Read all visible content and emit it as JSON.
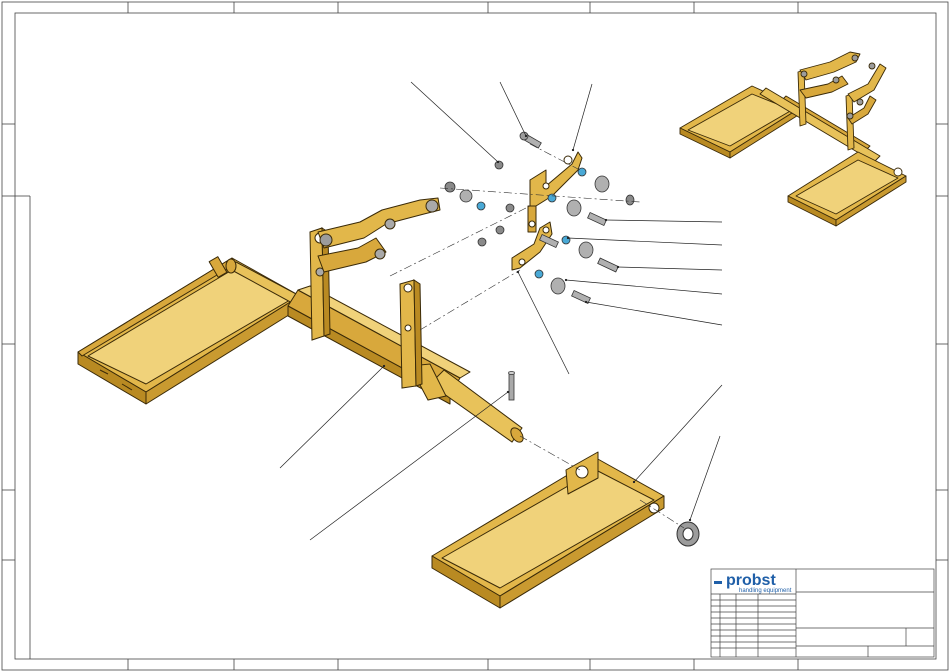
{
  "title_block": {
    "brand": "probst",
    "tagline": "handling equipment"
  },
  "colors": {
    "part_fill": "#e2b74a",
    "part_light": "#f0d27a",
    "part_dark": "#b98a22",
    "outline": "#3a2a08",
    "hardware": "#9c9c9c",
    "washer_blue": "#49a9d6",
    "brand_blue": "#1f5fa8",
    "frame": "#444444"
  }
}
